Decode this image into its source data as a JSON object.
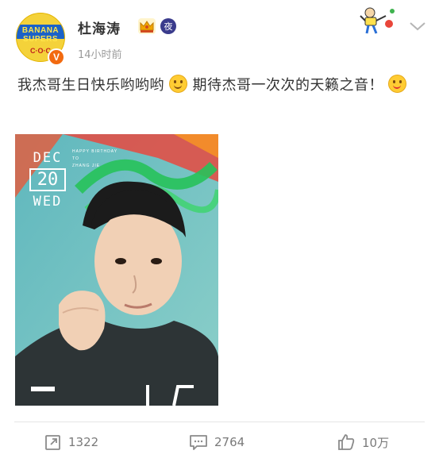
{
  "user": {
    "name": "杜海涛",
    "avatar_text_top": "BANANA SUPERS",
    "avatar_text_bottom": "C·O·C",
    "verified_badge": "V",
    "night_badge": "夜",
    "time": "14小时前"
  },
  "post": {
    "text_part1": "我杰哥生日快乐哟哟哟",
    "text_part2": "期待杰哥一次次的天籁之音！",
    "photo": {
      "month": "DEC",
      "day": "20",
      "weekday": "WED",
      "caption_line1": "HAPPY BIRTHDAY",
      "caption_line2": "TO",
      "caption_line3": "ZHANG JIE"
    }
  },
  "actions": {
    "repost_count": "1322",
    "comment_count": "2764",
    "like_count": "10万"
  },
  "icons": [
    "crown-icon",
    "night-badge-icon",
    "sticker-icon",
    "chevron-down-icon",
    "repost-icon",
    "comment-icon",
    "like-icon"
  ],
  "colors": {
    "verified": "#f26a10",
    "text": "#333333",
    "meta": "#9a9a9a"
  }
}
